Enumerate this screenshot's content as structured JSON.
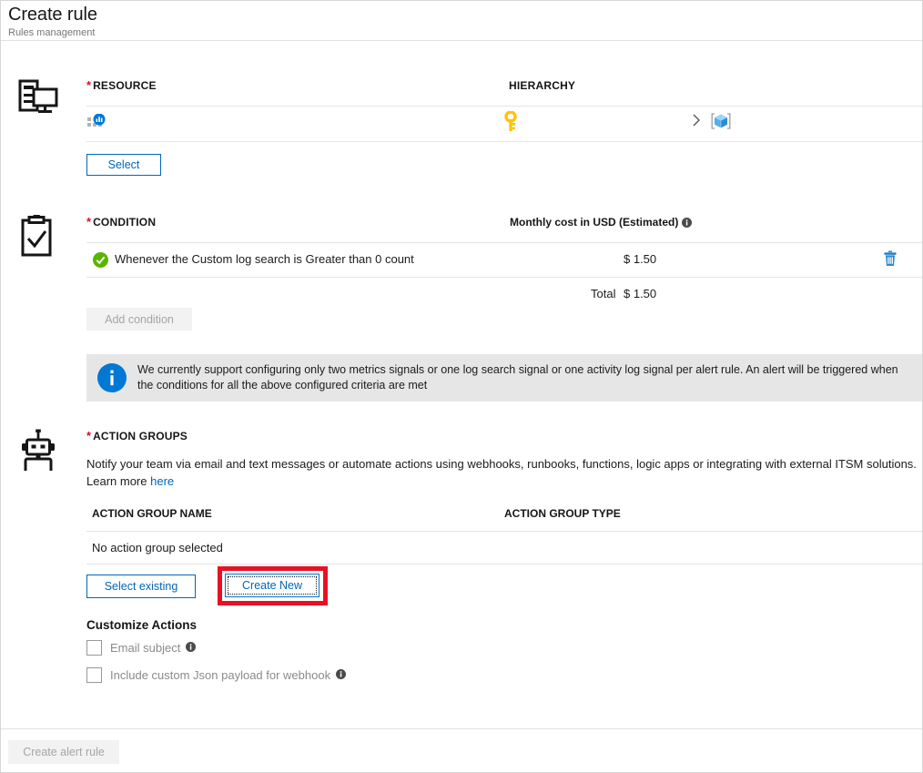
{
  "header": {
    "title": "Create rule",
    "subtitle": "Rules management"
  },
  "resource": {
    "icon": "server-monitor-icon",
    "label": "RESOURCE",
    "required_marker": "*",
    "hierarchy_label": "HIERARCHY",
    "resource_item_icon": "application-insights-icon",
    "hierarchy_subscription_icon": "key-icon",
    "hierarchy_separator_icon": "chevron-right-icon",
    "hierarchy_resource_group_icon": "resource-group-cube-icon",
    "select_button": "Select"
  },
  "condition": {
    "icon": "clipboard-check-icon",
    "label": "CONDITION",
    "required_marker": "*",
    "cost_column_label": "Monthly cost in USD (Estimated)",
    "cost_info_icon": "info-icon",
    "rows": [
      {
        "status_icon": "green-check-icon",
        "text": "Whenever the Custom log search is Greater than 0 count",
        "cost": "$ 1.50",
        "delete_icon": "trash-icon"
      }
    ],
    "total_label": "Total",
    "total_value": "$ 1.50",
    "add_condition_button": "Add condition",
    "banner": {
      "icon": "info-circle-icon",
      "text": "We currently support configuring only two metrics signals or one log search signal or one activity log signal per alert rule. An alert will be triggered when the conditions for all the above configured criteria are met"
    }
  },
  "action_groups": {
    "icon": "robot-icon",
    "label": "ACTION GROUPS",
    "required_marker": "*",
    "description": "Notify your team via email and text messages or automate actions using webhooks, runbooks, functions, logic apps or integrating with external ITSM solutions.",
    "learn_more_prefix": "Learn more",
    "learn_more_link": "here",
    "columns": {
      "name": "ACTION GROUP NAME",
      "type": "ACTION GROUP TYPE"
    },
    "empty_text": "No action group selected",
    "select_existing_button": "Select existing",
    "create_new_button": "Create New",
    "customize_title": "Customize Actions",
    "checkboxes": [
      {
        "label": "Email subject",
        "checked": false,
        "info_icon": "info-icon"
      },
      {
        "label": "Include custom Json payload for webhook",
        "checked": false,
        "info_icon": "info-icon"
      }
    ]
  },
  "footer": {
    "create_button": "Create alert rule"
  },
  "colors": {
    "accent": "#0067b8",
    "required": "#e00b1c",
    "annotation": "#e81123",
    "success": "#5ab500",
    "info_blue": "#0078d4",
    "key_yellow": "#ffc20e"
  }
}
